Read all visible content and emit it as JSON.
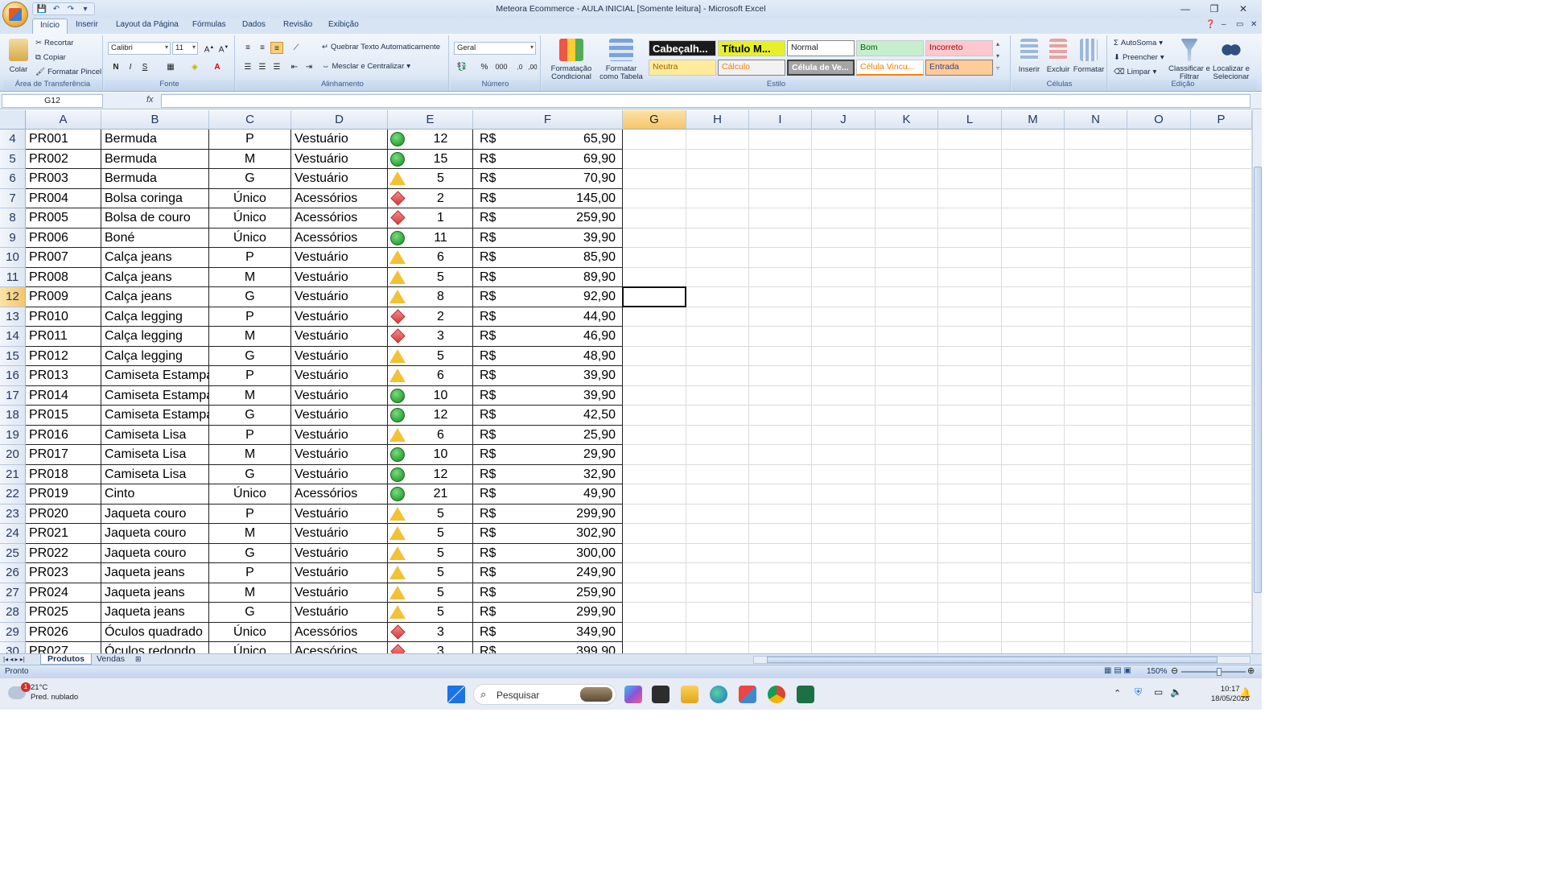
{
  "window": {
    "title": "Meteora Ecommerce - AULA INICIAL  [Somente leitura] - Microsoft Excel"
  },
  "ribbon": {
    "tabs": [
      "Início",
      "Inserir",
      "Layout da Página",
      "Fórmulas",
      "Dados",
      "Revisão",
      "Exibição"
    ],
    "clipboard": {
      "paste": "Colar",
      "cut": "Recortar",
      "copy": "Copiar",
      "format_painter": "Formatar Pincel",
      "label": "Área de Transferência"
    },
    "font": {
      "name": "Calibri",
      "size": "11",
      "bold": "N",
      "italic": "I",
      "underline": "S",
      "label": "Fonte"
    },
    "alignment": {
      "wrap_text": "Quebrar Texto Automaticamente",
      "merge_center": "Mesclar e Centralizar",
      "label": "Alinhamento"
    },
    "number": {
      "format": "Geral",
      "percent": "%",
      "thousands": "000",
      "label": "Número"
    },
    "styles": {
      "conditional": "Formatação Condicional",
      "as_table": "Formatar como Tabela",
      "cells": [
        "Cabeçalh...",
        "Título M...",
        "Normal",
        "Bom",
        "Incorreto",
        "Neutra",
        "Cálculo",
        "Célula de Ve...",
        "Célula Vincu...",
        "Entrada"
      ],
      "label": "Estilo"
    },
    "cells_group": {
      "insert": "Inserir",
      "delete": "Excluir",
      "format": "Formatar",
      "label": "Células"
    },
    "editing": {
      "autosum": "AutoSoma",
      "fill": "Preencher",
      "clear": "Limpar",
      "sort_filter": "Classificar e Filtrar",
      "find_select": "Localizar e Selecionar",
      "label": "Edição"
    }
  },
  "formula_bar": {
    "name_box": "G12",
    "fx": "fx",
    "content": ""
  },
  "columns": [
    "A",
    "B",
    "C",
    "D",
    "E",
    "F",
    "G",
    "H",
    "I",
    "J",
    "K",
    "L",
    "M",
    "N",
    "O",
    "P"
  ],
  "rows": [
    {
      "num": "4",
      "id": "PR001",
      "name": "Bermuda",
      "size": "P",
      "category": "Vestuário",
      "status": "green",
      "qty": "12",
      "currency": "R$",
      "price": "65,90"
    },
    {
      "num": "5",
      "id": "PR002",
      "name": "Bermuda",
      "size": "M",
      "category": "Vestuário",
      "status": "green",
      "qty": "15",
      "currency": "R$",
      "price": "69,90"
    },
    {
      "num": "6",
      "id": "PR003",
      "name": "Bermuda",
      "size": "G",
      "category": "Vestuário",
      "status": "yellow",
      "qty": "5",
      "currency": "R$",
      "price": "70,90"
    },
    {
      "num": "7",
      "id": "PR004",
      "name": "Bolsa coringa",
      "size": "Único",
      "category": "Acessórios",
      "status": "red",
      "qty": "2",
      "currency": "R$",
      "price": "145,00"
    },
    {
      "num": "8",
      "id": "PR005",
      "name": "Bolsa de couro",
      "size": "Único",
      "category": "Acessórios",
      "status": "red",
      "qty": "1",
      "currency": "R$",
      "price": "259,90"
    },
    {
      "num": "9",
      "id": "PR006",
      "name": "Boné",
      "size": "Único",
      "category": "Acessórios",
      "status": "green",
      "qty": "11",
      "currency": "R$",
      "price": "39,90"
    },
    {
      "num": "10",
      "id": "PR007",
      "name": "Calça jeans",
      "size": "P",
      "category": "Vestuário",
      "status": "yellow",
      "qty": "6",
      "currency": "R$",
      "price": "85,90"
    },
    {
      "num": "11",
      "id": "PR008",
      "name": "Calça jeans",
      "size": "M",
      "category": "Vestuário",
      "status": "yellow",
      "qty": "5",
      "currency": "R$",
      "price": "89,90"
    },
    {
      "num": "12",
      "id": "PR009",
      "name": "Calça jeans",
      "size": "G",
      "category": "Vestuário",
      "status": "yellow",
      "qty": "8",
      "currency": "R$",
      "price": "92,90"
    },
    {
      "num": "13",
      "id": "PR010",
      "name": "Calça legging",
      "size": "P",
      "category": "Vestuário",
      "status": "red",
      "qty": "2",
      "currency": "R$",
      "price": "44,90"
    },
    {
      "num": "14",
      "id": "PR011",
      "name": "Calça legging",
      "size": "M",
      "category": "Vestuário",
      "status": "red",
      "qty": "3",
      "currency": "R$",
      "price": "46,90"
    },
    {
      "num": "15",
      "id": "PR012",
      "name": "Calça legging",
      "size": "G",
      "category": "Vestuário",
      "status": "yellow",
      "qty": "5",
      "currency": "R$",
      "price": "48,90"
    },
    {
      "num": "16",
      "id": "PR013",
      "name": "Camiseta Estampa",
      "size": "P",
      "category": "Vestuário",
      "status": "yellow",
      "qty": "6",
      "currency": "R$",
      "price": "39,90"
    },
    {
      "num": "17",
      "id": "PR014",
      "name": "Camiseta Estampa",
      "size": "M",
      "category": "Vestuário",
      "status": "green",
      "qty": "10",
      "currency": "R$",
      "price": "39,90"
    },
    {
      "num": "18",
      "id": "PR015",
      "name": "Camiseta Estampa",
      "size": "G",
      "category": "Vestuário",
      "status": "green",
      "qty": "12",
      "currency": "R$",
      "price": "42,50"
    },
    {
      "num": "19",
      "id": "PR016",
      "name": "Camiseta Lisa",
      "size": "P",
      "category": "Vestuário",
      "status": "yellow",
      "qty": "6",
      "currency": "R$",
      "price": "25,90"
    },
    {
      "num": "20",
      "id": "PR017",
      "name": "Camiseta Lisa",
      "size": "M",
      "category": "Vestuário",
      "status": "green",
      "qty": "10",
      "currency": "R$",
      "price": "29,90"
    },
    {
      "num": "21",
      "id": "PR018",
      "name": "Camiseta Lisa",
      "size": "G",
      "category": "Vestuário",
      "status": "green",
      "qty": "12",
      "currency": "R$",
      "price": "32,90"
    },
    {
      "num": "22",
      "id": "PR019",
      "name": "Cinto",
      "size": "Único",
      "category": "Acessórios",
      "status": "green",
      "qty": "21",
      "currency": "R$",
      "price": "49,90"
    },
    {
      "num": "23",
      "id": "PR020",
      "name": "Jaqueta couro",
      "size": "P",
      "category": "Vestuário",
      "status": "yellow",
      "qty": "5",
      "currency": "R$",
      "price": "299,90"
    },
    {
      "num": "24",
      "id": "PR021",
      "name": "Jaqueta couro",
      "size": "M",
      "category": "Vestuário",
      "status": "yellow",
      "qty": "5",
      "currency": "R$",
      "price": "302,90"
    },
    {
      "num": "25",
      "id": "PR022",
      "name": "Jaqueta couro",
      "size": "G",
      "category": "Vestuário",
      "status": "yellow",
      "qty": "5",
      "currency": "R$",
      "price": "300,00"
    },
    {
      "num": "26",
      "id": "PR023",
      "name": "Jaqueta jeans",
      "size": "P",
      "category": "Vestuário",
      "status": "yellow",
      "qty": "5",
      "currency": "R$",
      "price": "249,90"
    },
    {
      "num": "27",
      "id": "PR024",
      "name": "Jaqueta jeans",
      "size": "M",
      "category": "Vestuário",
      "status": "yellow",
      "qty": "5",
      "currency": "R$",
      "price": "259,90"
    },
    {
      "num": "28",
      "id": "PR025",
      "name": "Jaqueta jeans",
      "size": "G",
      "category": "Vestuário",
      "status": "yellow",
      "qty": "5",
      "currency": "R$",
      "price": "299,90"
    },
    {
      "num": "29",
      "id": "PR026",
      "name": "Óculos quadrado",
      "size": "Único",
      "category": "Acessórios",
      "status": "red",
      "qty": "3",
      "currency": "R$",
      "price": "349,90"
    },
    {
      "num": "30",
      "id": "PR027",
      "name": "Óculos redondo",
      "size": "Único",
      "category": "Acessórios",
      "status": "red",
      "qty": "3",
      "currency": "R$",
      "price": "399,90"
    }
  ],
  "selected_cell": {
    "column": "G",
    "row": "12"
  },
  "sheets": [
    "Produtos",
    "Vendas"
  ],
  "active_sheet": "Produtos",
  "status_bar": {
    "mode": "Pronto",
    "zoom": "150%"
  },
  "taskbar": {
    "weather_temp": "21°C",
    "weather_desc": "Pred. nublado",
    "weather_badge": "1",
    "search": "Pesquisar",
    "time": "10:17",
    "date": "18/05/2026"
  },
  "colors": {
    "green": "#2fa43a",
    "yellow": "#f3c136",
    "red": "#d83b3b",
    "selection_header": "#f4c66a"
  }
}
